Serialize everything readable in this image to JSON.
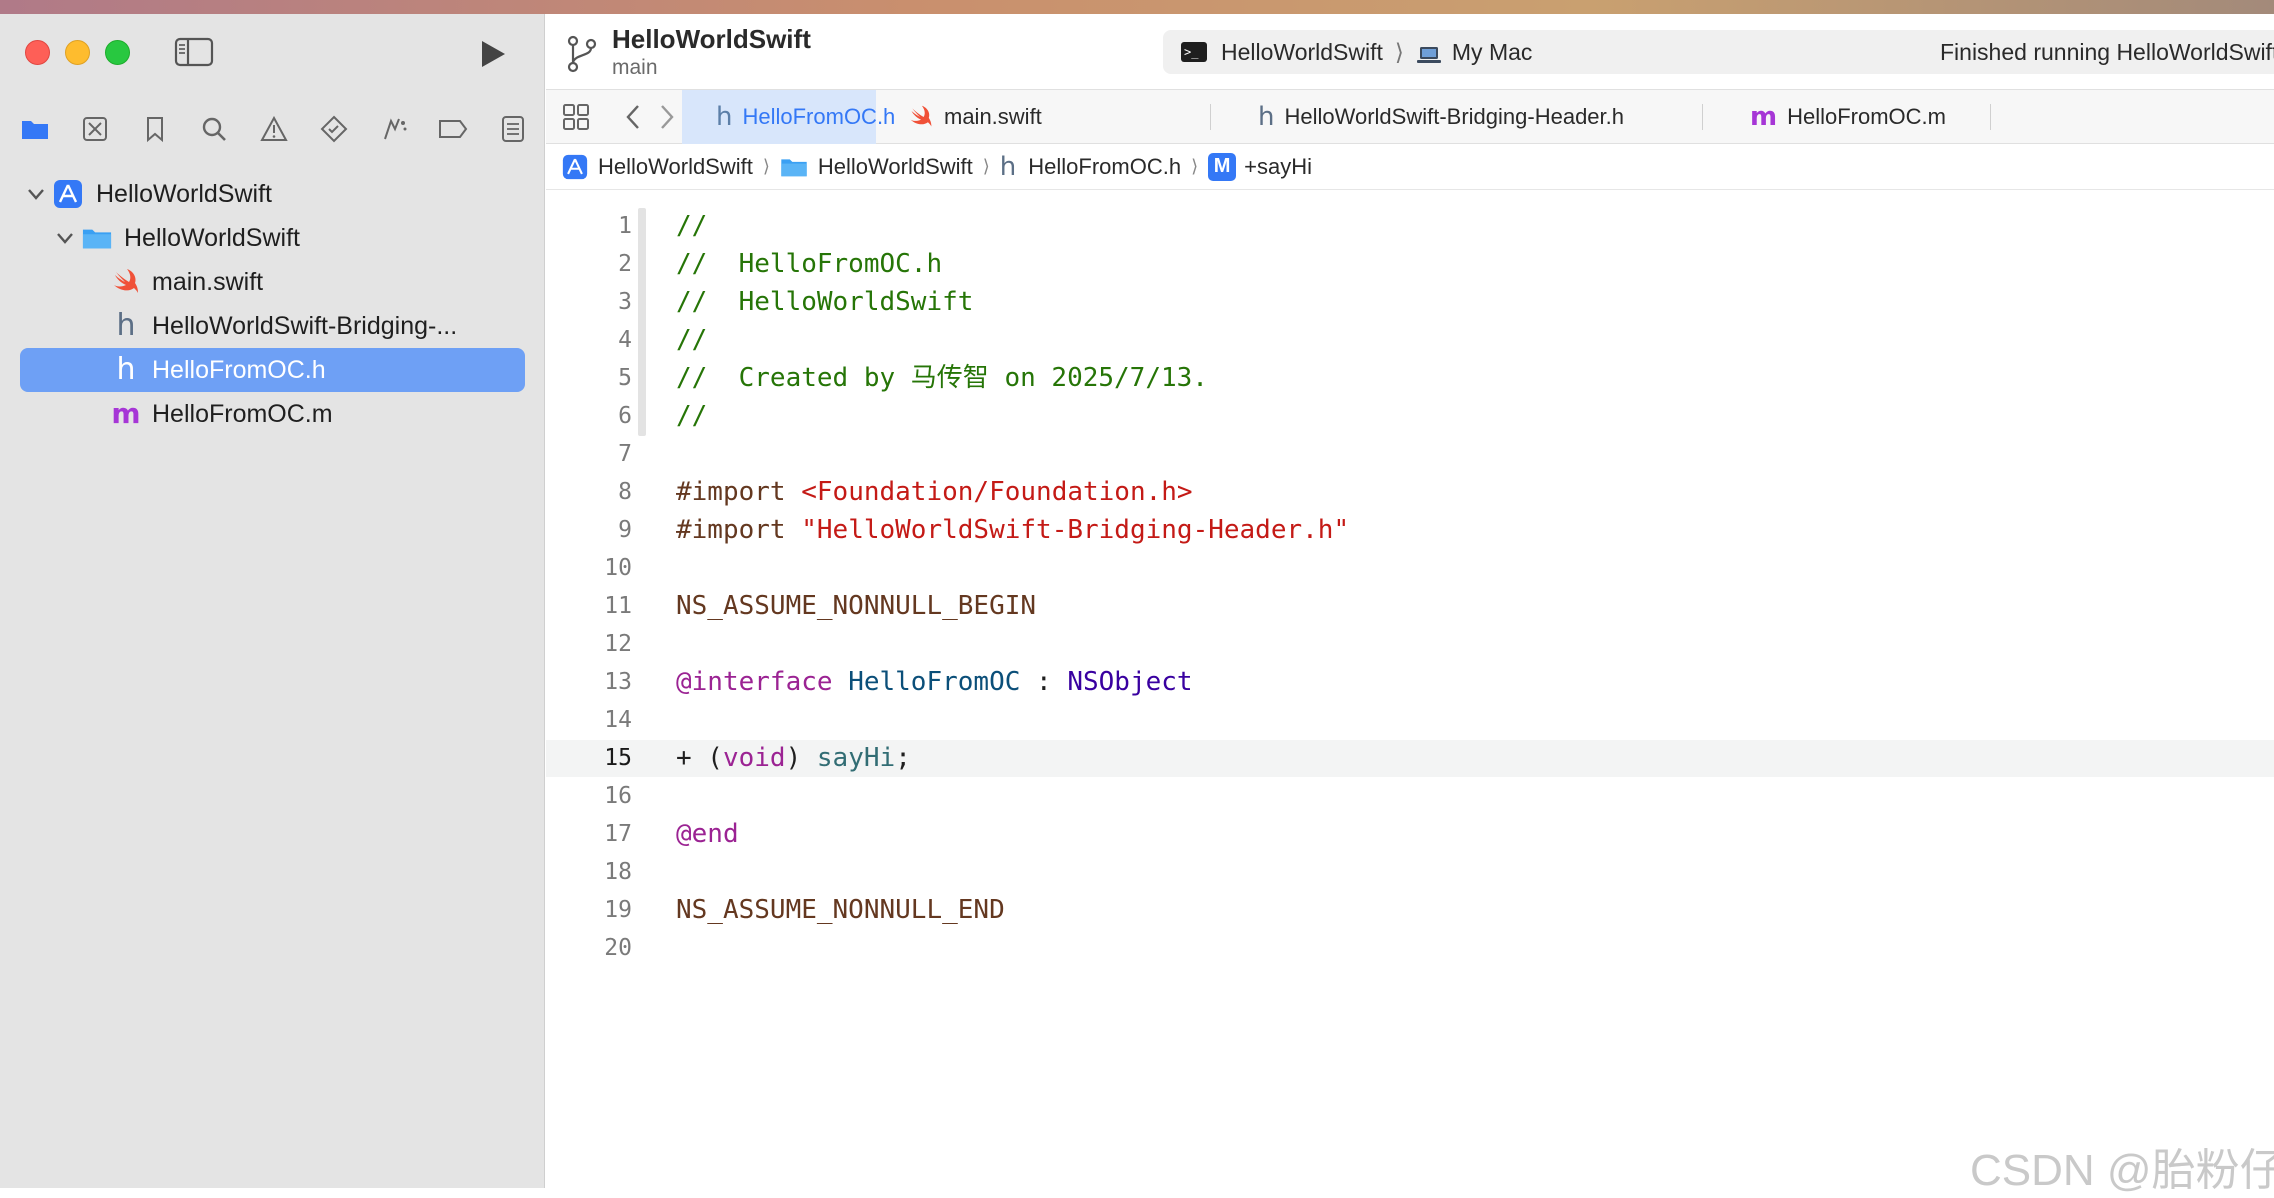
{
  "window": {
    "project_title": "HelloWorldSwift",
    "branch": "main"
  },
  "scheme": {
    "target": "HelloWorldSwift",
    "separator": "⟩",
    "destination": "My Mac",
    "status": "Finished running HelloWorldSwift"
  },
  "navigator": {
    "items": [
      {
        "label": "HelloWorldSwift",
        "kind": "project"
      },
      {
        "label": "HelloWorldSwift",
        "kind": "folder"
      },
      {
        "label": "main.swift",
        "kind": "swift"
      },
      {
        "label": "HelloWorldSwift-Bridging-...",
        "kind": "header"
      },
      {
        "label": "HelloFromOC.h",
        "kind": "header",
        "selected": true
      },
      {
        "label": "HelloFromOC.m",
        "kind": "implementation"
      }
    ]
  },
  "tabs": [
    {
      "label": "HelloFromOC.h",
      "icon": "h",
      "active": true
    },
    {
      "label": "main.swift",
      "icon": "swift"
    },
    {
      "label": "HelloWorldSwift-Bridging-Header.h",
      "icon": "h"
    },
    {
      "label": "HelloFromOC.m",
      "icon": "m"
    }
  ],
  "jumpbar": {
    "project": "HelloWorldSwift",
    "folder": "HelloWorldSwift",
    "file": "HelloFromOC.h",
    "badge": "M",
    "symbol": "+sayHi",
    "chevron": "⟩"
  },
  "editor": {
    "current_line": 15,
    "lines": [
      {
        "n": "1",
        "t": "//"
      },
      {
        "n": "2",
        "t": "//  HelloFromOC.h"
      },
      {
        "n": "3",
        "t": "//  HelloWorldSwift"
      },
      {
        "n": "4",
        "t": "//"
      },
      {
        "n": "5",
        "t": "//  Created by 马传智 on 2025/7/13."
      },
      {
        "n": "6",
        "t": "//"
      },
      {
        "n": "7",
        "t": ""
      },
      {
        "n": "8",
        "t": "#import <Foundation/Foundation.h>"
      },
      {
        "n": "9",
        "t": "#import \"HelloWorldSwift-Bridging-Header.h\""
      },
      {
        "n": "10",
        "t": ""
      },
      {
        "n": "11",
        "t": "NS_ASSUME_NONNULL_BEGIN"
      },
      {
        "n": "12",
        "t": ""
      },
      {
        "n": "13",
        "t": "@interface HelloFromOC : NSObject"
      },
      {
        "n": "14",
        "t": ""
      },
      {
        "n": "15",
        "t": "+ (void) sayHi;"
      },
      {
        "n": "16",
        "t": ""
      },
      {
        "n": "17",
        "t": "@end"
      },
      {
        "n": "18",
        "t": ""
      },
      {
        "n": "19",
        "t": "NS_ASSUME_NONNULL_END"
      },
      {
        "n": "20",
        "t": ""
      }
    ]
  },
  "tokens": {
    "l1": "//",
    "l2": "//  HelloFromOC.h",
    "l3": "//  HelloWorldSwift",
    "l4": "//",
    "l5": "//  Created by 马传智 on 2025/7/13.",
    "l6": "//",
    "l8_kw": "#import ",
    "l8_str": "<Foundation/Foundation.h>",
    "l9_kw": "#import ",
    "l9_str": "\"HelloWorldSwift-Bridging-Header.h\"",
    "l11": "NS_ASSUME_NONNULL_BEGIN",
    "l13_kw": "@interface ",
    "l13_cls": "HelloFromOC",
    "l13_colon": " : ",
    "l13_sup": "NSObject",
    "l15_plus": "+ (",
    "l15_void": "void",
    "l15_close": ") ",
    "l15_meth": "sayHi",
    "l15_semi": ";",
    "l17": "@end",
    "l19": "NS_ASSUME_NONNULL_END"
  },
  "watermark": "CSDN @胎粉仔",
  "colors": {
    "accent": "#3478f6",
    "selection": "#6ea0f5",
    "comment": "#267507",
    "string": "#c41a16",
    "keyword": "#9b2393",
    "preprocessor": "#643820"
  }
}
